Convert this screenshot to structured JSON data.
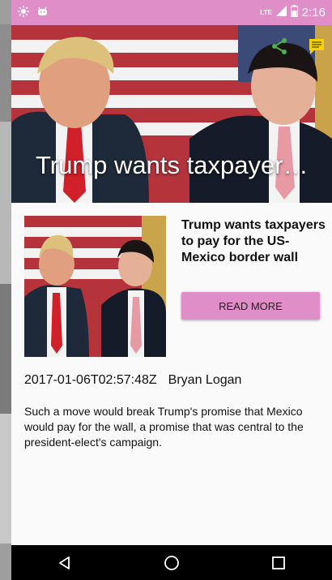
{
  "theme": {
    "accent": "#e08ec8",
    "nav_bg": "#000000",
    "background": "#fafafa"
  },
  "status_bar": {
    "left_icons": [
      "brightness-icon",
      "android-icon"
    ],
    "network_label": "LTE",
    "right_icons": [
      "signal-icon",
      "battery-icon"
    ],
    "time": "2:16"
  },
  "hero": {
    "title": "Trump wants taxpayers to pay for the US-Mexico border wall",
    "actions": [
      "share-icon",
      "comment-icon"
    ]
  },
  "article": {
    "headline": "Trump wants taxpayers to pay for the US-Mexico border wall",
    "button_label": "READ MORE",
    "date": "2017-01-06T02:57:48Z",
    "author": "Bryan Logan",
    "description": "Such a move would break Trump's promise that Mexico would pay for the wall, a promise that was central to the president-elect's campaign."
  },
  "nav": {
    "buttons": [
      "back-icon",
      "home-icon",
      "recents-icon"
    ]
  }
}
